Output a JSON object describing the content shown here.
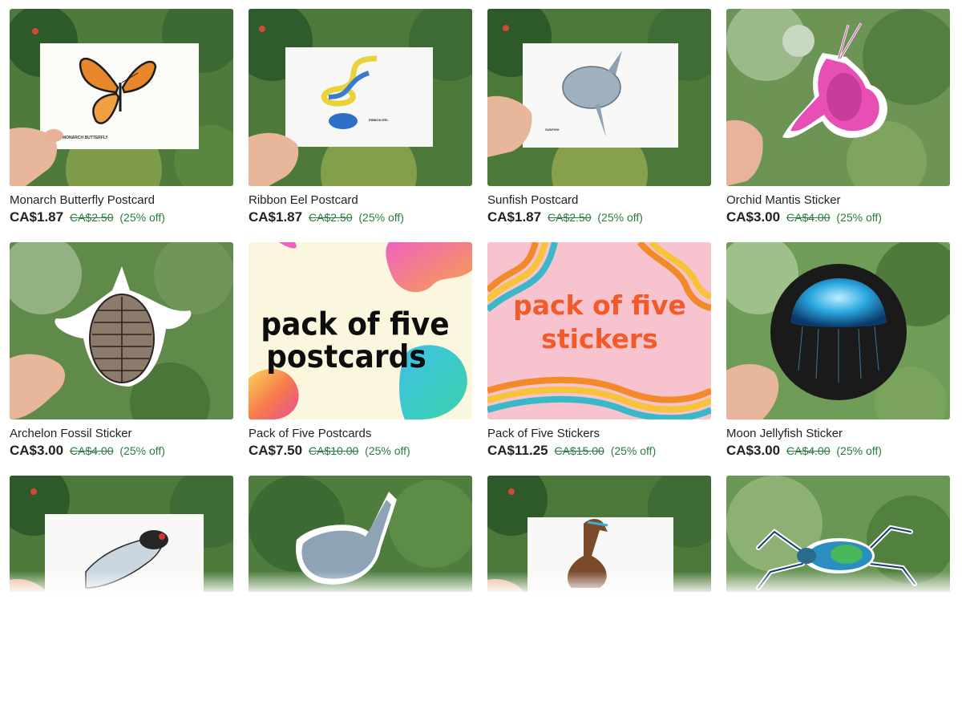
{
  "listings": [
    {
      "title": "Monarch Butterfly Postcard",
      "price": "CA$1.87",
      "original": "CA$2.50",
      "discount": "(25% off)",
      "card_text": "MONARCH BUTTERFLY"
    },
    {
      "title": "Ribbon Eel Postcard",
      "price": "CA$1.87",
      "original": "CA$2.50",
      "discount": "(25% off)",
      "card_text": "RIBBON EEL"
    },
    {
      "title": "Sunfish Postcard",
      "price": "CA$1.87",
      "original": "CA$2.50",
      "discount": "(25% off)",
      "card_text": "SUNFISH"
    },
    {
      "title": "Orchid Mantis Sticker",
      "price": "CA$3.00",
      "original": "CA$4.00",
      "discount": "(25% off)"
    },
    {
      "title": "Archelon Fossil Sticker",
      "price": "CA$3.00",
      "original": "CA$4.00",
      "discount": "(25% off)"
    },
    {
      "title": "Pack of Five Postcards",
      "price": "CA$7.50",
      "original": "CA$10.00",
      "discount": "(25% off)",
      "graphic_text": [
        "pack of five",
        "postcards"
      ]
    },
    {
      "title": "Pack of Five Stickers",
      "price": "CA$11.25",
      "original": "CA$15.00",
      "discount": "(25% off)",
      "graphic_text": [
        "pack of five",
        "stickers"
      ]
    },
    {
      "title": "Moon Jellyfish Sticker",
      "price": "CA$3.00",
      "original": "CA$4.00",
      "discount": "(25% off)"
    }
  ],
  "colors": {
    "discount_green": "#2a7d3e",
    "foliage_dark": "#2f5a2e",
    "foliage_light": "#6f9a55"
  }
}
